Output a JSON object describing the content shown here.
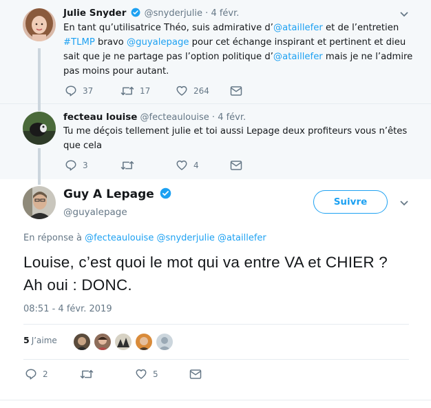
{
  "tweets": [
    {
      "name": "Julie Snyder",
      "handle": "@snyderjulie",
      "dot": "·",
      "time": "4 févr.",
      "verified": true,
      "text_parts": [
        {
          "t": "En tant qu’utilisatrice Théo, suis admirative d’",
          "link": false
        },
        {
          "t": "@ataillefer",
          "link": true
        },
        {
          "t": " et de l’entretien ",
          "link": false
        },
        {
          "t": "#TLMP",
          "link": true
        },
        {
          "t": " bravo ",
          "link": false
        },
        {
          "t": "@guyalepage",
          "link": true
        },
        {
          "t": " pour cet échange inspirant et pertinent et dieu sait que je ne partage pas l’option politique d’",
          "link": false
        },
        {
          "t": "@ataillefer",
          "link": true
        },
        {
          "t": " mais je ne l’admire pas moins pour autant.",
          "link": false
        }
      ],
      "replies": "37",
      "retweets": "17",
      "likes": "264"
    },
    {
      "name": "fecteau louise",
      "handle": "@fecteaulouise",
      "dot": "·",
      "time": "4 févr.",
      "verified": false,
      "text": "Tu me déçois tellement julie  et toi aussi Lepage deux profiteurs vous n’êtes que cela",
      "replies": "3",
      "retweets": "",
      "likes": "4"
    }
  ],
  "main": {
    "name": "Guy A Lepage",
    "handle": "@guyalepage",
    "follow_label": "Suivre",
    "reply_prefix": "En réponse à",
    "reply_to": [
      "@fecteaulouise",
      "@snyderjulie",
      "@ataillefer"
    ],
    "text": "Louise, c’est quoi le mot qui va entre VA et CHIER ? Ah oui : DONC.",
    "timestamp": "08:51 - 4 févr. 2019",
    "likes_count": "5",
    "likes_label": "J’aime",
    "replies": "2",
    "retweets": "",
    "likes": "5"
  },
  "colors": {
    "link": "#1da1f2",
    "muted": "#657786",
    "context_bg": "#f5f8fa",
    "thread_line": "#ccd6dd"
  },
  "icons": [
    "reply-icon",
    "retweet-icon",
    "like-icon",
    "message-icon",
    "verified-icon",
    "chevron-down-icon"
  ]
}
